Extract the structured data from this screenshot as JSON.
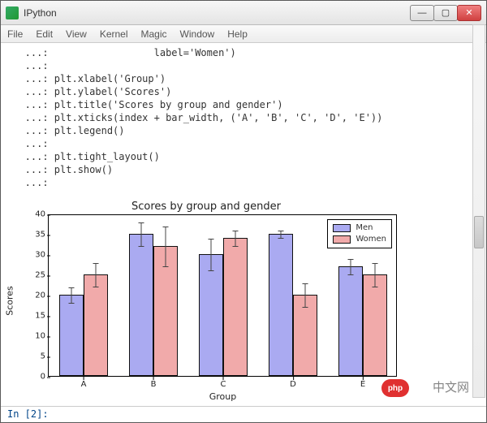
{
  "window": {
    "title": "IPython",
    "buttons": {
      "min": "—",
      "max": "▢",
      "close": "✕"
    }
  },
  "menu": [
    "File",
    "Edit",
    "View",
    "Kernel",
    "Magic",
    "Window",
    "Help"
  ],
  "code": [
    "   ...:                  label='Women')",
    "   ...: ",
    "   ...: plt.xlabel('Group')",
    "   ...: plt.ylabel('Scores')",
    "   ...: plt.title('Scores by group and gender')",
    "   ...: plt.xticks(index + bar_width, ('A', 'B', 'C', 'D', 'E'))",
    "   ...: plt.legend()",
    "   ...: ",
    "   ...: plt.tight_layout()",
    "   ...: plt.show()",
    "   ...: "
  ],
  "chart_data": {
    "type": "bar",
    "title": "Scores by group and gender",
    "xlabel": "Group",
    "ylabel": "Scores",
    "categories": [
      "A",
      "B",
      "C",
      "D",
      "E"
    ],
    "series": [
      {
        "name": "Men",
        "values": [
          20,
          35,
          30,
          35,
          27
        ],
        "err": [
          2,
          3,
          4,
          1,
          2
        ],
        "color": "rgba(100,100,230,0.55)"
      },
      {
        "name": "Women",
        "values": [
          25,
          32,
          34,
          20,
          25
        ],
        "err": [
          3,
          5,
          2,
          3,
          3
        ],
        "color": "rgba(230,100,100,0.55)"
      }
    ],
    "ylim": [
      0,
      40
    ],
    "yticks": [
      0,
      5,
      10,
      15,
      20,
      25,
      30,
      35,
      40
    ],
    "legend_position": "upper right"
  },
  "status": "In [2]:",
  "watermark": {
    "badge": "php",
    "text": "中文网"
  }
}
